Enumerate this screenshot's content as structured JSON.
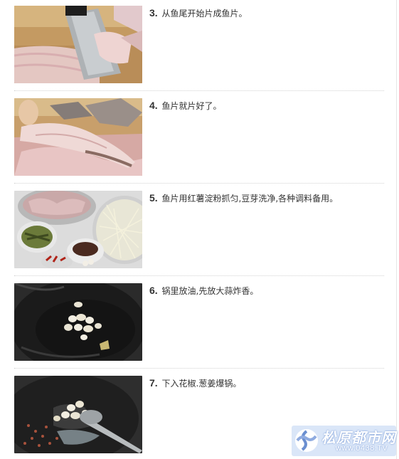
{
  "steps": [
    {
      "number": "3.",
      "text": "从鱼尾开始片成鱼片。",
      "photo": "knife-slicing-fish-photo"
    },
    {
      "number": "4.",
      "text": "鱼片就片好了。",
      "photo": "fish-slices-photo"
    },
    {
      "number": "5.",
      "text": "鱼片用红薯淀粉抓匀,豆芽洗净,各种调料备用。",
      "photo": "ingredients-photo"
    },
    {
      "number": "6.",
      "text": "锅里放油,先放大蒜炸香。",
      "photo": "garlic-in-wok-photo"
    },
    {
      "number": "7.",
      "text": "下入花椒.葱姜爆锅。",
      "photo": "spices-in-wok-photo"
    }
  ],
  "watermark": {
    "title": "松原都市网",
    "url": "www.0438.TV"
  },
  "colors": {
    "text": "#333333",
    "separator": "#d2d2d2",
    "watermark_bg": "#cdddf6"
  }
}
